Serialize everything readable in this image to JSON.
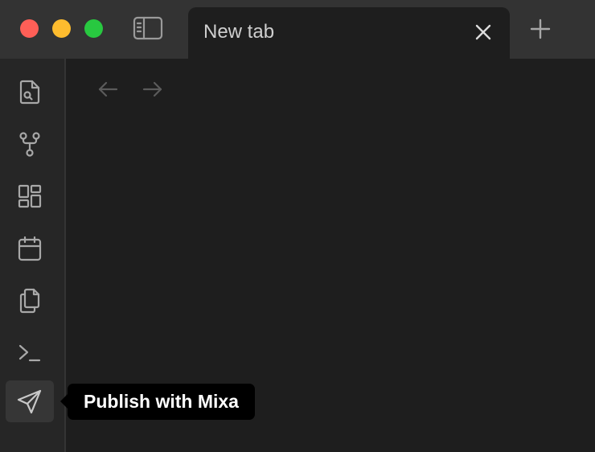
{
  "window": {
    "controls": [
      "close",
      "minimize",
      "zoom"
    ],
    "colors": {
      "close": "#ff5f57",
      "minimize": "#febc2e",
      "zoom": "#28c840"
    }
  },
  "tabs": [
    {
      "label": "New tab",
      "active": true
    }
  ],
  "titlebar_icons": {
    "sidebar_toggle": "sidebar-toggle-icon",
    "new_tab": "plus-icon",
    "tab_close": "close-icon"
  },
  "navigation": {
    "back": "arrow-left-icon",
    "forward": "arrow-right-icon"
  },
  "ribbon": {
    "items": [
      {
        "icon": "file-search-icon"
      },
      {
        "icon": "git-fork-icon"
      },
      {
        "icon": "layout-dashboard-icon"
      },
      {
        "icon": "calendar-icon"
      },
      {
        "icon": "copy-files-icon"
      },
      {
        "icon": "terminal-icon"
      },
      {
        "icon": "send-icon",
        "active": true
      }
    ]
  },
  "tooltip": {
    "text": "Publish with Mixa"
  }
}
